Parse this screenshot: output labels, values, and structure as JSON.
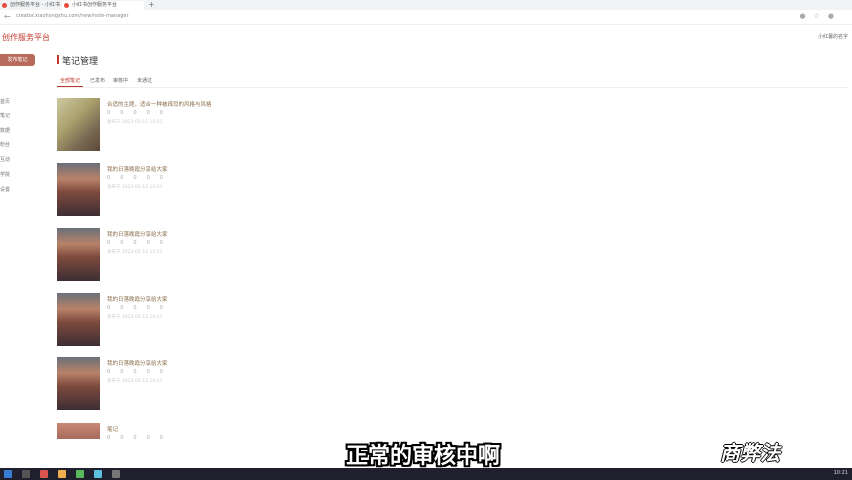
{
  "browser": {
    "tabs": [
      {
        "label": "创作服务平台 - 小红书"
      },
      {
        "label": "小红书创作服务平台"
      }
    ],
    "url": "creator.xiaohongshu.com/new/note-manager"
  },
  "header": {
    "logo": "创作服务平台",
    "user": "小红薯的名字"
  },
  "sidebar": {
    "publish_label": "发布笔记",
    "items": [
      "首页",
      "笔记",
      "数据",
      "粉丝",
      "互动",
      "学院",
      "设置"
    ]
  },
  "main": {
    "title": "笔记管理",
    "tabs": [
      "全部笔记",
      "已发布",
      "审核中",
      "未通过"
    ],
    "notes": [
      {
        "title": "合适的主题，适合一种被疏忽的风格与风格",
        "time": "发布于 2023-05-12 10:21"
      },
      {
        "title": "我的日落晚霞分享给大家",
        "time": "发布于 2023-05-12 10:21"
      },
      {
        "title": "我的日落晚霞分享给大家",
        "time": "发布于 2023-05-12 10:21"
      },
      {
        "title": "我的日落晚霞分享给大家",
        "time": "发布于 2023-05-12 10:21"
      },
      {
        "title": "我的日落晚霞分享给大家",
        "time": "发布于 2023-05-12 10:21"
      },
      {
        "title": "笔记",
        "time": ""
      }
    ],
    "stats": [
      "0",
      "0",
      "0",
      "0",
      "0"
    ]
  },
  "overlay": {
    "subtitle": "正常的审核中啊",
    "watermark": "商弊法"
  },
  "taskbar": {
    "clock": "10:21"
  }
}
